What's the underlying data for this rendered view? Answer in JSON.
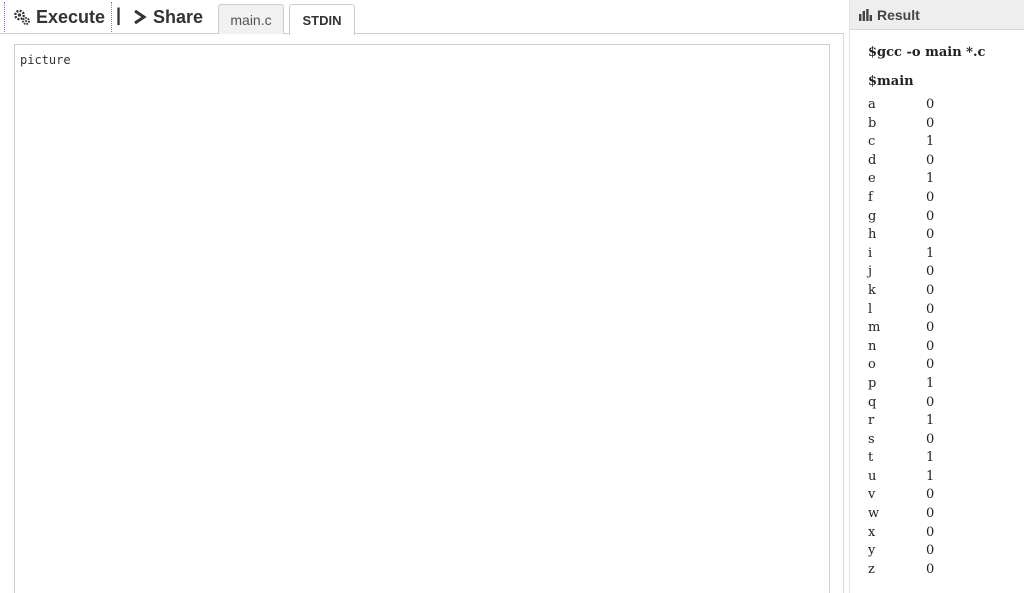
{
  "toolbar": {
    "execute_label": "Execute",
    "separator": "|",
    "share_label": "Share",
    "tabs": [
      {
        "label": "main.c",
        "active": false
      },
      {
        "label": "STDIN",
        "active": true
      }
    ]
  },
  "editor": {
    "content": "picture"
  },
  "result": {
    "header": "Result",
    "compile_cmd": "$gcc -o main *.c",
    "run_cmd": "$main",
    "rows": [
      {
        "k": "a",
        "v": "0"
      },
      {
        "k": "b",
        "v": "0"
      },
      {
        "k": "c",
        "v": "1"
      },
      {
        "k": "d",
        "v": "0"
      },
      {
        "k": "e",
        "v": "1"
      },
      {
        "k": "f",
        "v": "0"
      },
      {
        "k": "g",
        "v": "0"
      },
      {
        "k": "h",
        "v": "0"
      },
      {
        "k": "i",
        "v": "1"
      },
      {
        "k": "j",
        "v": "0"
      },
      {
        "k": "k",
        "v": "0"
      },
      {
        "k": "l",
        "v": "0"
      },
      {
        "k": "m",
        "v": "0"
      },
      {
        "k": "n",
        "v": "0"
      },
      {
        "k": "o",
        "v": "0"
      },
      {
        "k": "p",
        "v": "1"
      },
      {
        "k": "q",
        "v": "0"
      },
      {
        "k": "r",
        "v": "1"
      },
      {
        "k": "s",
        "v": "0"
      },
      {
        "k": "t",
        "v": "1"
      },
      {
        "k": "u",
        "v": "1"
      },
      {
        "k": "v",
        "v": "0"
      },
      {
        "k": "w",
        "v": "0"
      },
      {
        "k": "x",
        "v": "0"
      },
      {
        "k": "y",
        "v": "0"
      },
      {
        "k": "z",
        "v": "0"
      }
    ]
  },
  "icons": {
    "execute": "gears-icon",
    "share": "chevron-right-icon",
    "result": "bar-chart-icon"
  },
  "colors": {
    "header_bg": "#eeeeee",
    "border": "#cfcfcf",
    "text": "#333333"
  }
}
